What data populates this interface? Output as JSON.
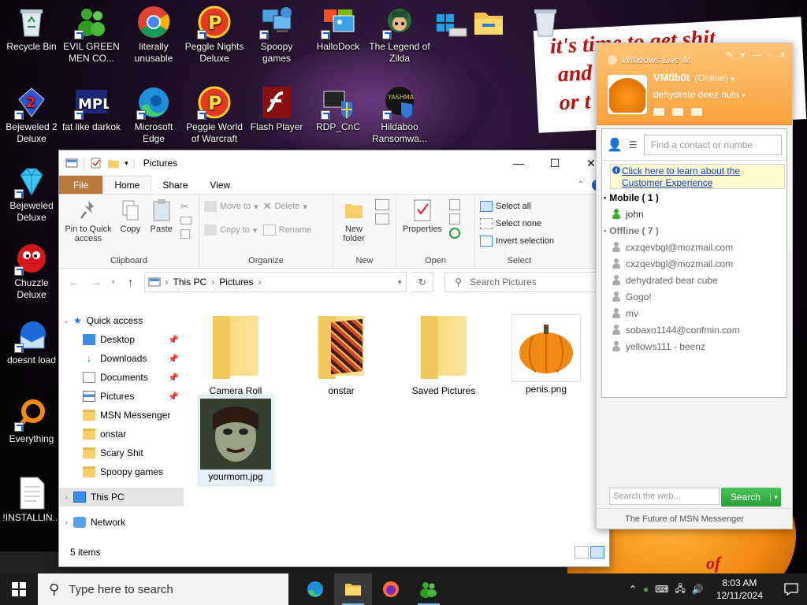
{
  "desktop": {
    "icons": [
      {
        "label": "Recycle Bin"
      },
      {
        "label": "EVIL GREEN MEN CO..."
      },
      {
        "label": "literally unusable"
      },
      {
        "label": "Peggle Nights Deluxe"
      },
      {
        "label": "Spoopy games"
      },
      {
        "label": "HalloDock"
      },
      {
        "label": "The Legend of Zilda"
      },
      {
        "label": "Bejeweled 2 Deluxe"
      },
      {
        "label": "fat like darkok"
      },
      {
        "label": "Microsoft Edge"
      },
      {
        "label": "Peggle World of Warcraft"
      },
      {
        "label": "Flash Player"
      },
      {
        "label": "RDP_CnC"
      },
      {
        "label": "Hildaboo Ransomwa..."
      },
      {
        "label": "Bejeweled Deluxe"
      },
      {
        "label": "Chuzzle Deluxe"
      },
      {
        "label": "doesnt load"
      },
      {
        "label": "Everything"
      },
      {
        "label": "!INSTALLIN..."
      }
    ],
    "wallpaper_text": [
      "it's time to get shit",
      "and",
      "or t"
    ],
    "wallpaper_bottom_text": "of"
  },
  "explorer": {
    "title": "Pictures",
    "tabs": {
      "file": "File",
      "home": "Home",
      "share": "Share",
      "view": "View"
    },
    "ribbon": {
      "clipboard": {
        "pin": "Pin to Quick access",
        "copy": "Copy",
        "paste": "Paste",
        "group": "Clipboard"
      },
      "organize": {
        "move_to": "Move to",
        "copy_to": "Copy to",
        "delete": "Delete",
        "rename": "Rename",
        "group": "Organize"
      },
      "new": {
        "new_folder": "New folder",
        "group": "New"
      },
      "open": {
        "properties": "Properties",
        "group": "Open"
      },
      "select": {
        "select_all": "Select all",
        "select_none": "Select none",
        "invert": "Invert selection",
        "group": "Select"
      }
    },
    "address": {
      "segments": [
        "This PC",
        "Pictures"
      ],
      "search_placeholder": "Search Pictures"
    },
    "nav": {
      "quick_access": "Quick access",
      "quick_items": [
        "Desktop",
        "Downloads",
        "Documents",
        "Pictures",
        "MSN Messenger",
        "onstar",
        "Scary Shit",
        "Spoopy games"
      ],
      "this_pc": "This PC",
      "network": "Network"
    },
    "items": [
      {
        "name": "Camera Roll",
        "type": "folder"
      },
      {
        "name": "onstar",
        "type": "folder"
      },
      {
        "name": "Saved Pictures",
        "type": "folder"
      },
      {
        "name": "penis.png",
        "type": "image"
      },
      {
        "name": "yourmom.jpg",
        "type": "image"
      }
    ],
    "status": "5 items"
  },
  "messenger": {
    "title": "Windows Live M",
    "user": {
      "name": "VM0b0t",
      "status": "(Online)",
      "message": "dehydrate deez nuts"
    },
    "find_placeholder": "Find a contact or numbe",
    "banner": "Click here to learn about the Customer Experience",
    "groups": [
      {
        "name": "Mobile ( 1 )",
        "contacts": [
          "john"
        ],
        "online": true
      },
      {
        "name": "Offline ( 7 )",
        "contacts": [
          "cxzqevbgl@mozmail.com",
          "cxzqevbgl@mozmail.com",
          "dehydrated bear cube",
          "Gogo!",
          "mv",
          "sobaxo1144@confmin.com",
          "yellows111 - beenz"
        ],
        "online": false
      }
    ],
    "search_placeholder": "Search the web...",
    "search_button": "Search",
    "footer": "The Future of MSN Messenger"
  },
  "taskbar": {
    "search_placeholder": "Type here to search",
    "time": "8:03 AM",
    "date": "12/11/2024"
  },
  "colors": {
    "file_tab": "#b77a3a",
    "msn_orange": "#f7a13d",
    "taskbar": "#1c1c1c",
    "accent": "#1a5fd0"
  }
}
